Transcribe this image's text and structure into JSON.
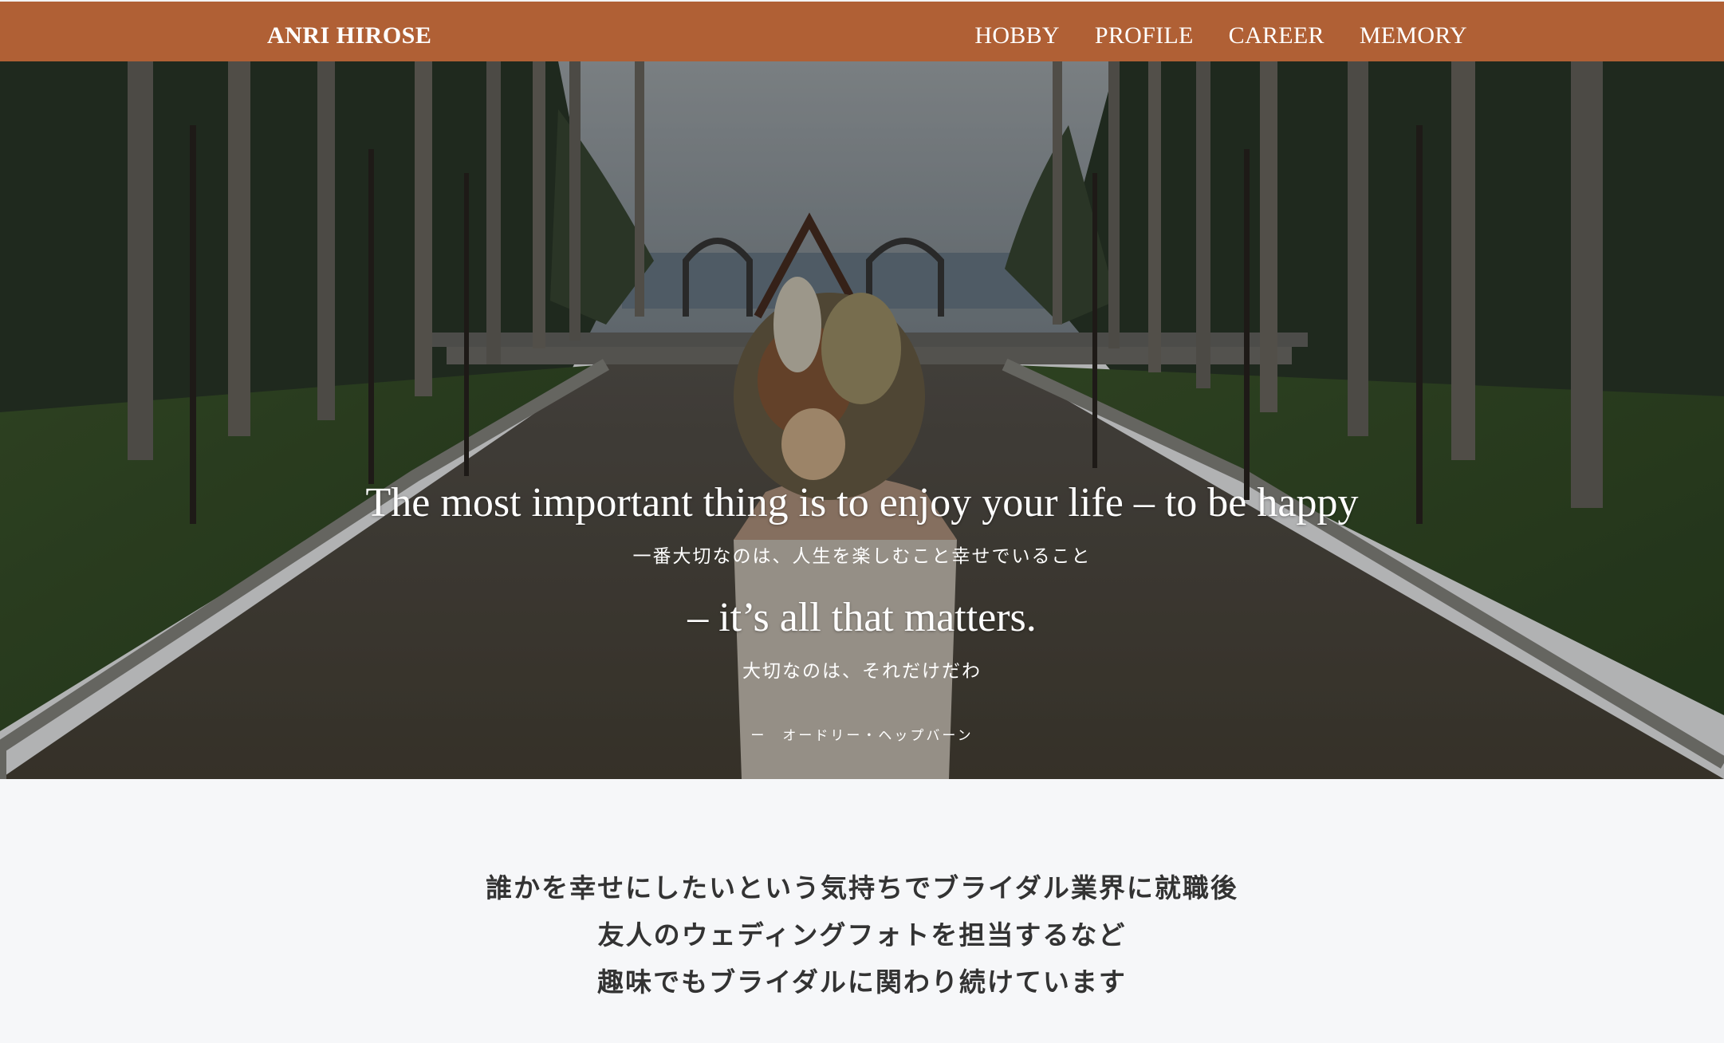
{
  "header": {
    "brand": "ANRI HIROSE",
    "nav": [
      "HOBBY",
      "PROFILE",
      "CAREER",
      "MEMORY"
    ]
  },
  "hero": {
    "quote_en_1": "The most important thing is to enjoy your life – to be happy",
    "quote_ja_1": "一番大切なのは、人生を楽しむこと幸せでいること",
    "quote_en_2": "– it’s all that matters.",
    "quote_ja_2": "大切なのは、それだけだわ",
    "author": "ー　オードリー・ヘップバーン"
  },
  "intro": {
    "lines": [
      "誰かを幸せにしたいという気持ちでブライダル業界に就職後",
      "友人のウェディングフォトを担当するなど",
      "趣味でもブライダルに関わり続けています"
    ]
  },
  "colors": {
    "nav_bg": "#b06035",
    "page_bg": "#f6f7f9",
    "text_dark": "#333333"
  }
}
